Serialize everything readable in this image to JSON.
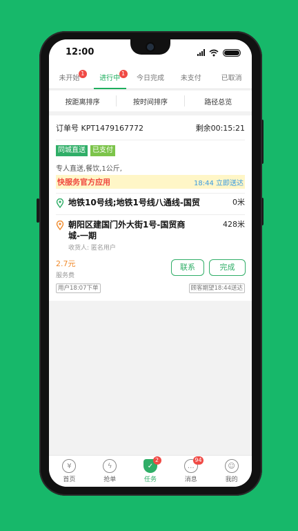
{
  "status_bar": {
    "time": "12:00"
  },
  "tabs": [
    {
      "label": "未开始",
      "badge": "1",
      "active": false
    },
    {
      "label": "进行中",
      "badge": "1",
      "active": true
    },
    {
      "label": "今日完成",
      "badge": null,
      "active": false
    },
    {
      "label": "未支付",
      "badge": null,
      "active": false
    },
    {
      "label": "已取消",
      "badge": null,
      "active": false
    }
  ],
  "sort": {
    "by_distance": "按距离排序",
    "by_time": "按时间排序",
    "route_overview": "路径总览"
  },
  "order": {
    "number_label": "订单号 KPT1479167772",
    "remaining": "剩余00:15:21",
    "tags": [
      "同城直送",
      "已支付"
    ],
    "description": "专人直送,餐饮,1公斤,",
    "banner_title": "快服务官方应用",
    "banner_time": "18:44 立即送达",
    "pickup": {
      "address": "地铁10号线;地铁1号线八通线-国贸",
      "distance": "0米"
    },
    "dropoff": {
      "address": "朝阳区建国门外大街1号-国贸商城-一期",
      "distance": "428米"
    },
    "receiver": "收货人:  匿名用户",
    "fee_amount": "2.7元",
    "fee_label": "服务费",
    "contact_label": "联系",
    "complete_label": "完成",
    "placed": "用户18:07下单",
    "expected": "顾客期望18:44送达"
  },
  "bottom_nav": [
    {
      "label": "首页",
      "icon": "yen-icon",
      "badge": null,
      "active": false
    },
    {
      "label": "抢单",
      "icon": "lightning-icon",
      "badge": null,
      "active": false
    },
    {
      "label": "任务",
      "icon": "task-check-icon",
      "badge": "2",
      "active": true
    },
    {
      "label": "消息",
      "icon": "message-icon",
      "badge": "94",
      "active": false
    },
    {
      "label": "我的",
      "icon": "smiley-icon",
      "badge": null,
      "active": false
    }
  ],
  "colors": {
    "accent": "#2fae67",
    "background": "#17b86a",
    "warning_text": "#f0483e",
    "fee_text": "#f08b2d",
    "link_text": "#3a9be0"
  }
}
